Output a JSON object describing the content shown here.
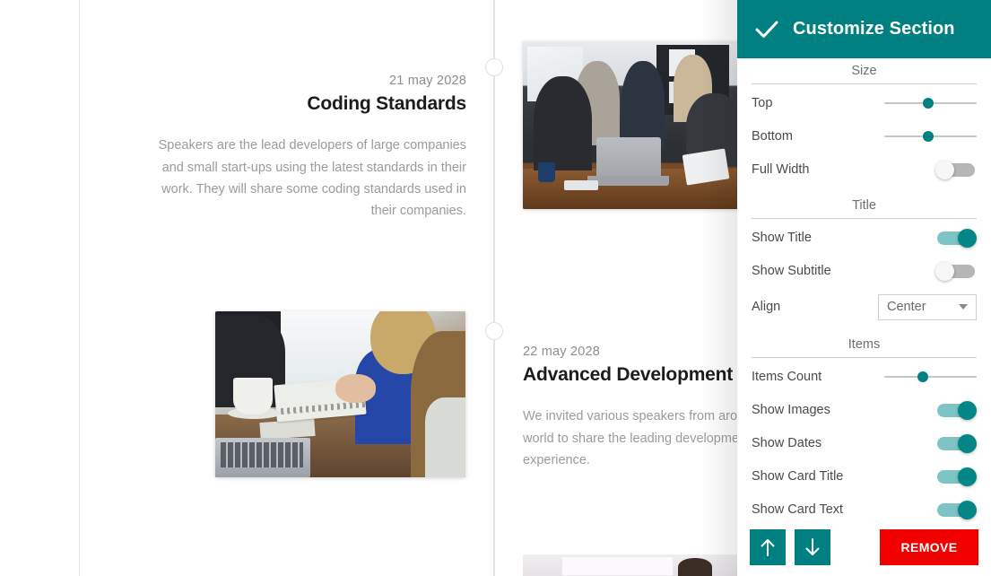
{
  "panel": {
    "title": "Customize Section",
    "confirm_icon": "check-icon",
    "accent_color": "#008080",
    "remove_color": "#f20000",
    "sections": {
      "size": {
        "heading": "Size",
        "top": {
          "label": "Top",
          "value": 48
        },
        "bottom": {
          "label": "Bottom",
          "value": 48
        },
        "full_width": {
          "label": "Full Width",
          "value": "off"
        }
      },
      "title": {
        "heading": "Title",
        "show_title": {
          "label": "Show Title",
          "value": "on"
        },
        "show_subtitle": {
          "label": "Show Subtitle",
          "value": "off"
        },
        "align": {
          "label": "Align",
          "value": "Center",
          "icon": "chevron-down-icon"
        }
      },
      "items": {
        "heading": "Items",
        "items_count": {
          "label": "Items Count",
          "value": 42
        },
        "show_images": {
          "label": "Show  Images",
          "value": "on"
        },
        "show_dates": {
          "label": "Show  Dates",
          "value": "on"
        },
        "show_card_title": {
          "label": "Show Card Title",
          "value": "on"
        },
        "show_card_text": {
          "label": "Show Card Text",
          "value": "on"
        }
      }
    },
    "footer": {
      "move_up": "↑",
      "move_down": "↓",
      "remove_label": "REMOVE"
    }
  },
  "content": {
    "entries": [
      {
        "date": "21 may 2028",
        "title": "Coding Standards",
        "body": "Speakers are the lead developers of large companies and small start-ups using the latest standards in their work. They will share some coding standards used in their companies."
      },
      {
        "date": "22 may 2028",
        "title": "Advanced Development Tools",
        "body": "We invited various speakers from around the world to share the leading development experience."
      }
    ],
    "images": [
      {
        "name": "business-meeting-photo"
      },
      {
        "name": "workspace-collaboration-photo"
      },
      {
        "name": "presentation-photo"
      }
    ]
  }
}
